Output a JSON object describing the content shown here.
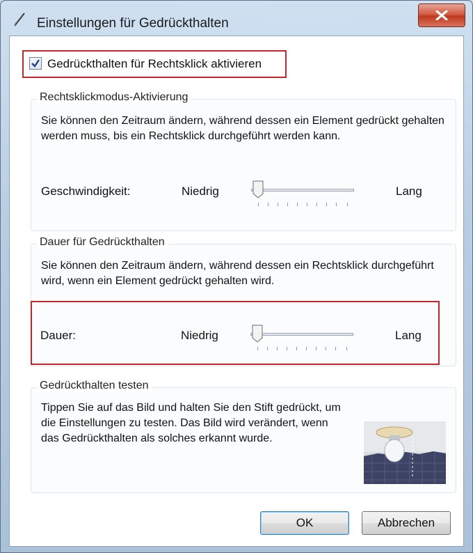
{
  "window": {
    "title": "Einstellungen für Gedrückthalten"
  },
  "enable": {
    "label": "Gedrückthalten für Rechtsklick aktivieren",
    "checked": true
  },
  "group1": {
    "title": "Rechtsklickmodus-Aktivierung",
    "description": "Sie können den Zeitraum ändern, während dessen ein Element gedrückt gehalten werden muss, bis ein Rechtsklick durchgeführt werden kann.",
    "row_label": "Geschwindigkeit:",
    "min_label": "Niedrig",
    "max_label": "Lang",
    "slider_value_fraction": 0.0
  },
  "group2": {
    "title": "Dauer für Gedrückthalten",
    "description": "Sie können den Zeitraum ändern, während dessen ein Rechtsklick durchgeführt wird, wenn ein Element gedrückt gehalten wird.",
    "row_label": "Dauer:",
    "min_label": "Niedrig",
    "max_label": "Lang",
    "slider_value_fraction": 0.0
  },
  "group3": {
    "title": "Gedrückthalten testen",
    "description": "Tippen Sie auf das Bild und halten Sie den Stift gedrückt, um die Einstellungen zu testen. Das Bild wird verändert, wenn das Gedrückthalten als solches erkannt wurde."
  },
  "buttons": {
    "ok": "OK",
    "cancel": "Abbrechen"
  },
  "colors": {
    "highlight_border": "#c8242a",
    "close_button": "#c0391f"
  },
  "icons": {
    "title": "pen-icon",
    "close": "close-icon",
    "check": "checkmark-icon",
    "preview": "lightbulb-image"
  }
}
